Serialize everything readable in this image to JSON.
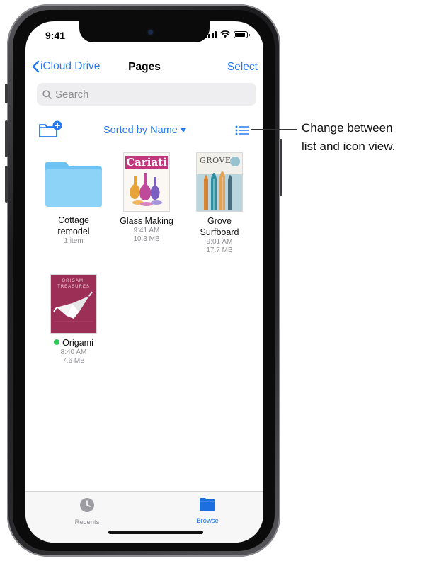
{
  "status_bar": {
    "time": "9:41"
  },
  "nav": {
    "back_label": "iCloud Drive",
    "title": "Pages",
    "select_label": "Select"
  },
  "search": {
    "placeholder": "Search"
  },
  "toolbar": {
    "sort_label": "Sorted by Name"
  },
  "items": [
    {
      "name_line1": "Cottage",
      "name_line2": "remodel",
      "meta1": "1 item",
      "meta2": "",
      "icon": "folder-icon"
    },
    {
      "name_line1": "Glass Making",
      "name_line2": "",
      "meta1": "9:41 AM",
      "meta2": "10.3 MB",
      "thumb_title": "Cariati"
    },
    {
      "name_line1": "Grove",
      "name_line2": "Surfboard",
      "meta1": "9:01 AM",
      "meta2": "17.7 MB",
      "thumb_title": "GROVE"
    },
    {
      "name_line1": "Origami",
      "name_line2": "",
      "meta1": "8:40 AM",
      "meta2": "7.6 MB",
      "thumb_title": "ORIGAMI",
      "thumb_subtitle": "TREASURES",
      "status": "synced"
    }
  ],
  "tabbar": {
    "recents_label": "Recents",
    "browse_label": "Browse"
  },
  "callout": {
    "line1": "Change between",
    "line2": "list and icon view."
  },
  "colors": {
    "accent": "#2479f2",
    "folder": "#7ecbf5",
    "synced_dot": "#34c759"
  }
}
